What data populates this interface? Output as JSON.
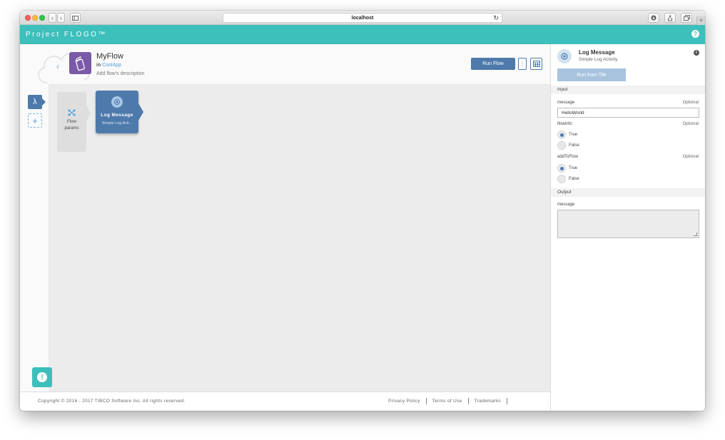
{
  "browser": {
    "url": "localhost",
    "reload_glyph": "↻",
    "nav_back_glyph": "‹",
    "nav_forward_glyph": "›",
    "plus_glyph": "+"
  },
  "app": {
    "brand": "Project FLOGO™",
    "help_glyph": "?",
    "accent_color": "#3dbfbc",
    "primary_color": "#4d7aab"
  },
  "sidebar": {
    "lambda_glyph": "λ",
    "add_glyph": "+",
    "alert_glyph": "!"
  },
  "flow": {
    "back_glyph": "‹",
    "name": "MyFlow",
    "in_prefix": "in",
    "app_name": "CoolApp",
    "description": "Add flow's description",
    "run_label": "Run Flow",
    "more_glyph": "⋮"
  },
  "canvas": {
    "params_label_1": "Flow",
    "params_label_2": "params",
    "tile_title": "Log Message",
    "tile_subtitle": "Simple Log Acti..."
  },
  "footer": {
    "copyright": "Copyright © 2016 - 2017 TIBCO Software Inc. All rights reserved.",
    "links": [
      "Privacy Policy",
      "Terms of Use",
      "Trademarks"
    ]
  },
  "panel": {
    "title": "Log Message",
    "subtitle": "Simple Log Activity",
    "info_glyph": "i",
    "run_tile_label": "Run from Tile",
    "input_heading": "Input",
    "output_heading": "Output",
    "inputs": {
      "message": {
        "label": "message",
        "optional": "Optional",
        "value": "HelloWorld"
      },
      "flowInfo": {
        "label": "flowInfo",
        "optional": "Optional",
        "selected": "True",
        "options": [
          "True",
          "False"
        ]
      },
      "addToFlow": {
        "label": "addToFlow",
        "optional": "Optional",
        "selected": "True",
        "options": [
          "True",
          "False"
        ]
      }
    },
    "outputs": {
      "message": {
        "label": "message",
        "value": ""
      }
    }
  }
}
